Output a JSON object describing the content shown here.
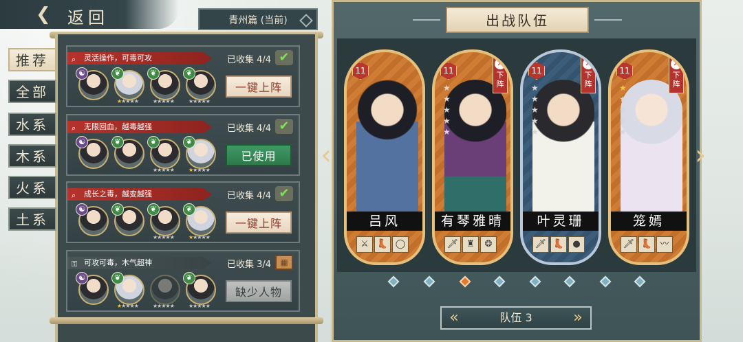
{
  "header": {
    "back_label": "返回",
    "chapter": "青州篇 (当前)"
  },
  "tabs": [
    {
      "label": "推荐",
      "active": true
    },
    {
      "label": "全部",
      "active": false
    },
    {
      "label": "水系",
      "active": false
    },
    {
      "label": "木系",
      "active": false
    },
    {
      "label": "火系",
      "active": false
    },
    {
      "label": "土系",
      "active": false
    }
  ],
  "cards": [
    {
      "tag": "灵活操作，可毒可攻",
      "collected": "已收集 4/4",
      "button": "一键上阵",
      "button_state": "deploy",
      "complete": true
    },
    {
      "tag": "无限回血，越毒越强",
      "collected": "已收集 4/4",
      "button": "已使用",
      "button_state": "used",
      "complete": true
    },
    {
      "tag": "成长之毒，越变越强",
      "collected": "已收集 4/4",
      "button": "一键上阵",
      "button_state": "deploy",
      "complete": true
    },
    {
      "tag": "可攻可毒，木气超神",
      "collected": "已收集 3/4",
      "button": "缺少人物",
      "button_state": "missing",
      "complete": false
    }
  ],
  "team": {
    "title": "出战队伍",
    "selector": "队伍 3",
    "remove_label": "下阵",
    "heroes": [
      {
        "name": "吕风",
        "level": "11",
        "stars": 0,
        "removable": false
      },
      {
        "name": "有琴雅晴",
        "level": "11",
        "stars": 0,
        "removable": true
      },
      {
        "name": "叶灵珊",
        "level": "11",
        "stars": 0,
        "removable": true
      },
      {
        "name": "笼嫣",
        "level": "11",
        "stars": 1,
        "removable": true
      }
    ],
    "page_count": 8,
    "active_page": 3
  },
  "colors": {
    "accent_red": "#b5332c",
    "used_green": "#2e7a4c",
    "frame_gold": "#c9b98f",
    "page_active": "#e8782a"
  }
}
